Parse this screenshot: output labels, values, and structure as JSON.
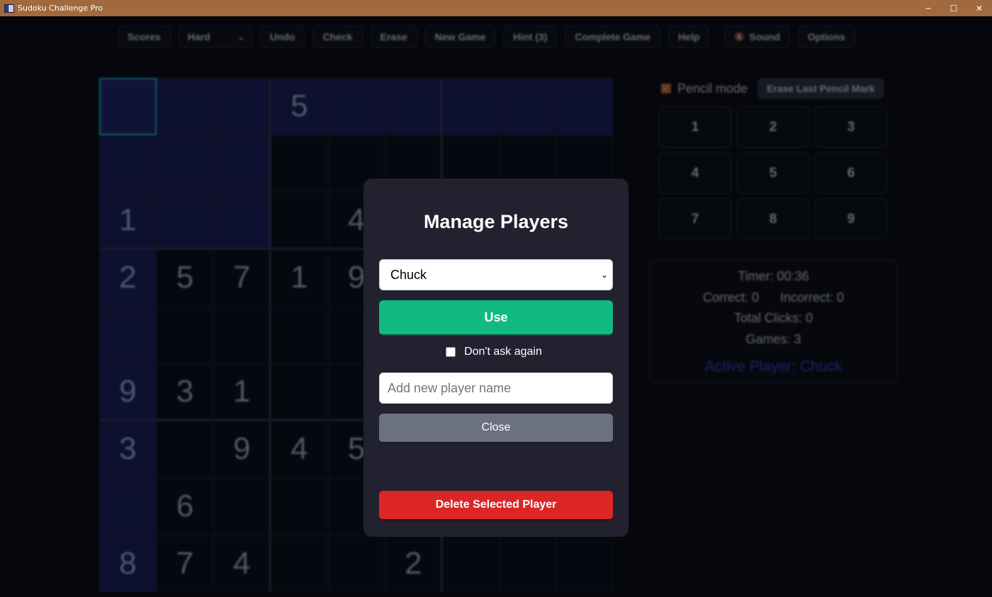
{
  "window": {
    "title": "Sudoku Challenge Pro",
    "minimize_glyph": "─",
    "maximize_glyph": "☐",
    "close_glyph": "✕"
  },
  "toolbar": {
    "scores": "Scores",
    "difficulty": "Hard",
    "difficulty_chevron": "⌄",
    "undo": "Undo",
    "check": "Check",
    "erase": "Erase",
    "new_game": "New Game",
    "hint": "Hint (3)",
    "complete_game": "Complete Game",
    "help": "Help",
    "sound_icon_glyph": "🔇",
    "sound": "Sound",
    "options": "Options"
  },
  "board": {
    "selected_cell": [
      0,
      0
    ],
    "highlight_row": 0,
    "highlight_col": 0,
    "highlight_box": [
      0,
      0
    ],
    "visible_values": [
      [
        0,
        3,
        "5"
      ],
      [
        2,
        0,
        "1"
      ],
      [
        2,
        4,
        "4"
      ],
      [
        3,
        0,
        "2"
      ],
      [
        3,
        1,
        "5"
      ],
      [
        3,
        2,
        "7"
      ],
      [
        3,
        3,
        "1"
      ],
      [
        3,
        4,
        "9"
      ],
      [
        5,
        0,
        "9"
      ],
      [
        5,
        1,
        "3"
      ],
      [
        5,
        2,
        "1"
      ],
      [
        6,
        0,
        "3"
      ],
      [
        6,
        2,
        "9"
      ],
      [
        6,
        3,
        "4"
      ],
      [
        6,
        4,
        "5"
      ],
      [
        7,
        1,
        "6"
      ],
      [
        8,
        0,
        "8"
      ],
      [
        8,
        1,
        "7"
      ],
      [
        8,
        2,
        "4"
      ],
      [
        8,
        5,
        "2"
      ]
    ]
  },
  "right_panel": {
    "pencil_mode_checked": true,
    "pencil_check_glyph": "✓",
    "pencil_mode_label": "Pencil mode",
    "erase_last_pencil": "Erase Last Pencil Mark",
    "numpad": [
      "1",
      "2",
      "3",
      "4",
      "5",
      "6",
      "7",
      "8",
      "9"
    ]
  },
  "stats": {
    "timer": "Timer: 00:36",
    "correct": "Correct: 0",
    "incorrect": "Incorrect: 0",
    "total_clicks": "Total Clicks: 0",
    "games": "Games: 3",
    "active_player": "Active Player: Chuck"
  },
  "modal": {
    "title": "Manage Players",
    "selected_player": "Chuck",
    "select_chevron": "⌄",
    "use_button": "Use",
    "dont_ask_again": "Don't ask again",
    "dont_ask_checked": false,
    "new_player_placeholder": "Add new player name",
    "close_button": "Close",
    "delete_button": "Delete Selected Player"
  },
  "colors": {
    "titlebar": "#a06a3e",
    "modal_bg": "#212130",
    "use_green": "#12b981",
    "close_gray": "#6b717e",
    "delete_red": "#dc2626",
    "active_player_blue": "#3a3ac8",
    "cell_highlight": "#171a52",
    "selected_border": "#1fb8c8"
  }
}
